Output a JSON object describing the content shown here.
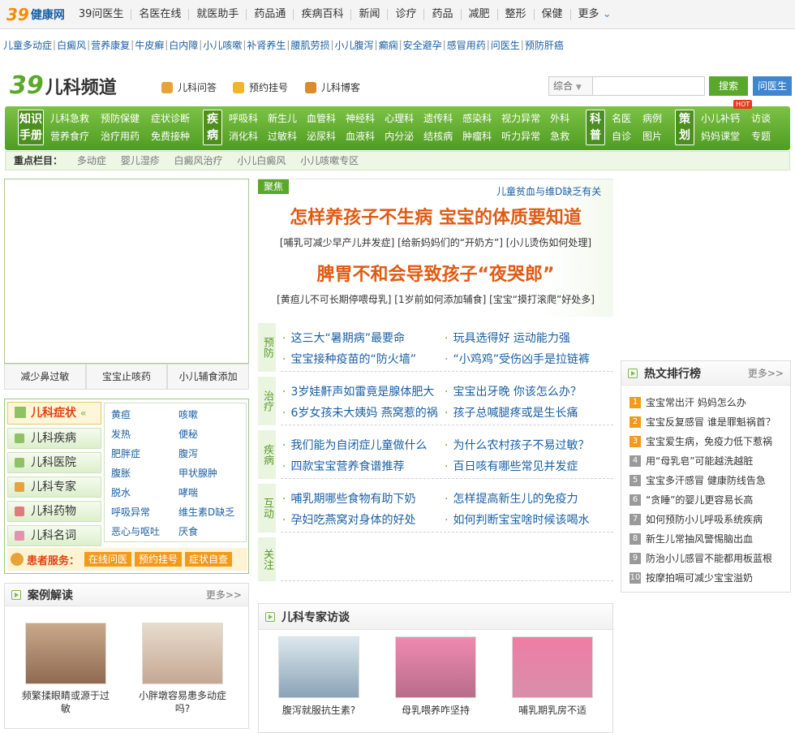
{
  "topnav": {
    "logo_num": "39",
    "logo_text": "健康网",
    "items": [
      "39问医生",
      "名医在线",
      "就医助手",
      "药品通",
      "疾病百科",
      "新闻",
      "诊疗",
      "药品",
      "减肥",
      "整形",
      "保健",
      "更多"
    ]
  },
  "subline": [
    "儿童多动症",
    "白癜风",
    "营养康复",
    "牛皮癣",
    "白内障",
    "小儿咳嗽",
    "补肾养生",
    "腰肌劳损",
    "小儿腹泻",
    "癫痫",
    "安全避孕",
    "感冒用药",
    "问医生",
    "预防肝癌"
  ],
  "header": {
    "logo_num": "39",
    "channel": "儿科频道",
    "links": [
      "儿科问答",
      "预约挂号",
      "儿科博客"
    ],
    "search_select": "综合",
    "search_btn": "搜索",
    "ask_btn": "问医生"
  },
  "greenbar": {
    "blocks": [
      {
        "tag": "知识手册",
        "links": [
          "儿科急救",
          "营养食疗",
          "预防保健",
          "治疗用药",
          "症状诊断",
          "免费接种"
        ]
      },
      {
        "tag": "疾病",
        "links": [
          "呼吸科",
          "消化科",
          "新生儿",
          "过敏科",
          "血管科",
          "泌尿科",
          "神经科",
          "血液科",
          "心理科",
          "内分泌",
          "遗传科",
          "结核病",
          "感染科",
          "肿瘤科",
          "视力异常",
          "听力异常",
          "外科",
          "急救"
        ]
      },
      {
        "tag": "科普",
        "links": [
          "名医",
          "自诊",
          "病例",
          "图片"
        ]
      },
      {
        "tag": "策划",
        "links": [
          "小儿补钙",
          "妈妈课堂",
          "访谈",
          "专题"
        ]
      }
    ],
    "hot_badge": "HOT"
  },
  "keybar": {
    "label": "重点栏目：",
    "items": [
      "多动症",
      "婴儿湿疹",
      "白癜风治疗",
      "小儿白癜风",
      "小儿咳嗽专区"
    ]
  },
  "left_tabs": [
    "减少鼻过敏",
    "宝宝止咳药",
    "小儿辅食添加"
  ],
  "symptoms": {
    "head": "儿科症状",
    "menu": [
      "儿科疾病",
      "儿科医院",
      "儿科专家",
      "儿科药物",
      "儿科名词"
    ],
    "grid": [
      "黄疸",
      "咳嗽",
      "发热",
      "便秘",
      "肥胖症",
      "腹泻",
      "腹胀",
      "甲状腺肿",
      "脱水",
      "哮喘",
      "呼吸异常",
      "维生素D缺乏",
      "恶心与呕吐",
      "厌食"
    ],
    "service_label": "患者服务：",
    "service": [
      "在线问医",
      "预约挂号",
      "症状自查"
    ]
  },
  "cases": {
    "title": "案例解读",
    "more": "更多>>",
    "items": [
      {
        "caption": "频繁揉眼睛或源于过敏"
      },
      {
        "caption": "小胖墩容易患多动症吗?"
      }
    ]
  },
  "focus": {
    "tag": "聚焦",
    "top_link": "儿童贫血与维D缺乏有关",
    "headline1": "怎样养孩子不生病 宝宝的体质要知道",
    "sub1": "[哺乳可减少早产儿并发症] [给新妈妈们的“开奶方”] [小儿烫伤如何处理]",
    "headline2": "脾胃不和会导致孩子“夜哭郎”",
    "sub2": "[黄疸儿不可长期停喂母乳] [1岁前如何添加辅食] [宝宝“摸打滚爬”好处多]"
  },
  "sections": [
    {
      "cat": "预防",
      "items": [
        "这三大“暑期病”最要命",
        "玩具选得好 运动能力强",
        "宝宝接种疫苗的“防火墙”",
        "“小鸡鸡”受伤凶手是拉链裤"
      ]
    },
    {
      "cat": "治疗",
      "items": [
        "3岁娃鼾声如雷竟是腺体肥大",
        "宝宝出牙晚 你该怎么办？",
        "6岁女孩未大姨妈 燕窝惹的祸",
        "孩子总喊腿疼或是生长痛"
      ]
    },
    {
      "cat": "疾病",
      "items": [
        "我们能为自闭症儿童做什么",
        "为什么农村孩子不易过敏？",
        "四款宝宝营养食谱推荐",
        "百日咳有哪些常见并发症"
      ]
    },
    {
      "cat": "互动",
      "items": [
        "哺乳期哪些食物有助下奶",
        "怎样提高新生儿的免疫力",
        "孕妇吃燕窝对身体的好处",
        "如何判断宝宝啥时候该喝水"
      ]
    },
    {
      "cat": "关注",
      "items": []
    }
  ],
  "experts": {
    "title": "儿科专家访谈",
    "items": [
      {
        "caption": "腹泻就服抗生素?"
      },
      {
        "caption": "母乳喂养咋坚持"
      },
      {
        "caption": "哺乳期乳房不适"
      }
    ]
  },
  "hot": {
    "title": "热文排行榜",
    "more": "更多>>",
    "items": [
      "宝宝常出汗 妈妈怎么办",
      "宝宝反复感冒 谁是罪魁祸首？",
      "宝宝爱生病，免疫力低下惹祸",
      "用“母乳皂”可能越洗越脏",
      "宝宝多汗感冒 健康防线告急",
      "“贪睡”的婴儿更容易长高",
      "如何预防小儿呼吸系统疾病",
      "新生儿常抽风警惕脑出血",
      "防治小儿感冒不能都用板蓝根",
      "按摩拍嗝可减少宝宝溢奶"
    ]
  },
  "colors": {
    "brand_green": "#5aa82a",
    "link_blue": "#1a5fa3",
    "headline_orange": "#e05a13"
  }
}
